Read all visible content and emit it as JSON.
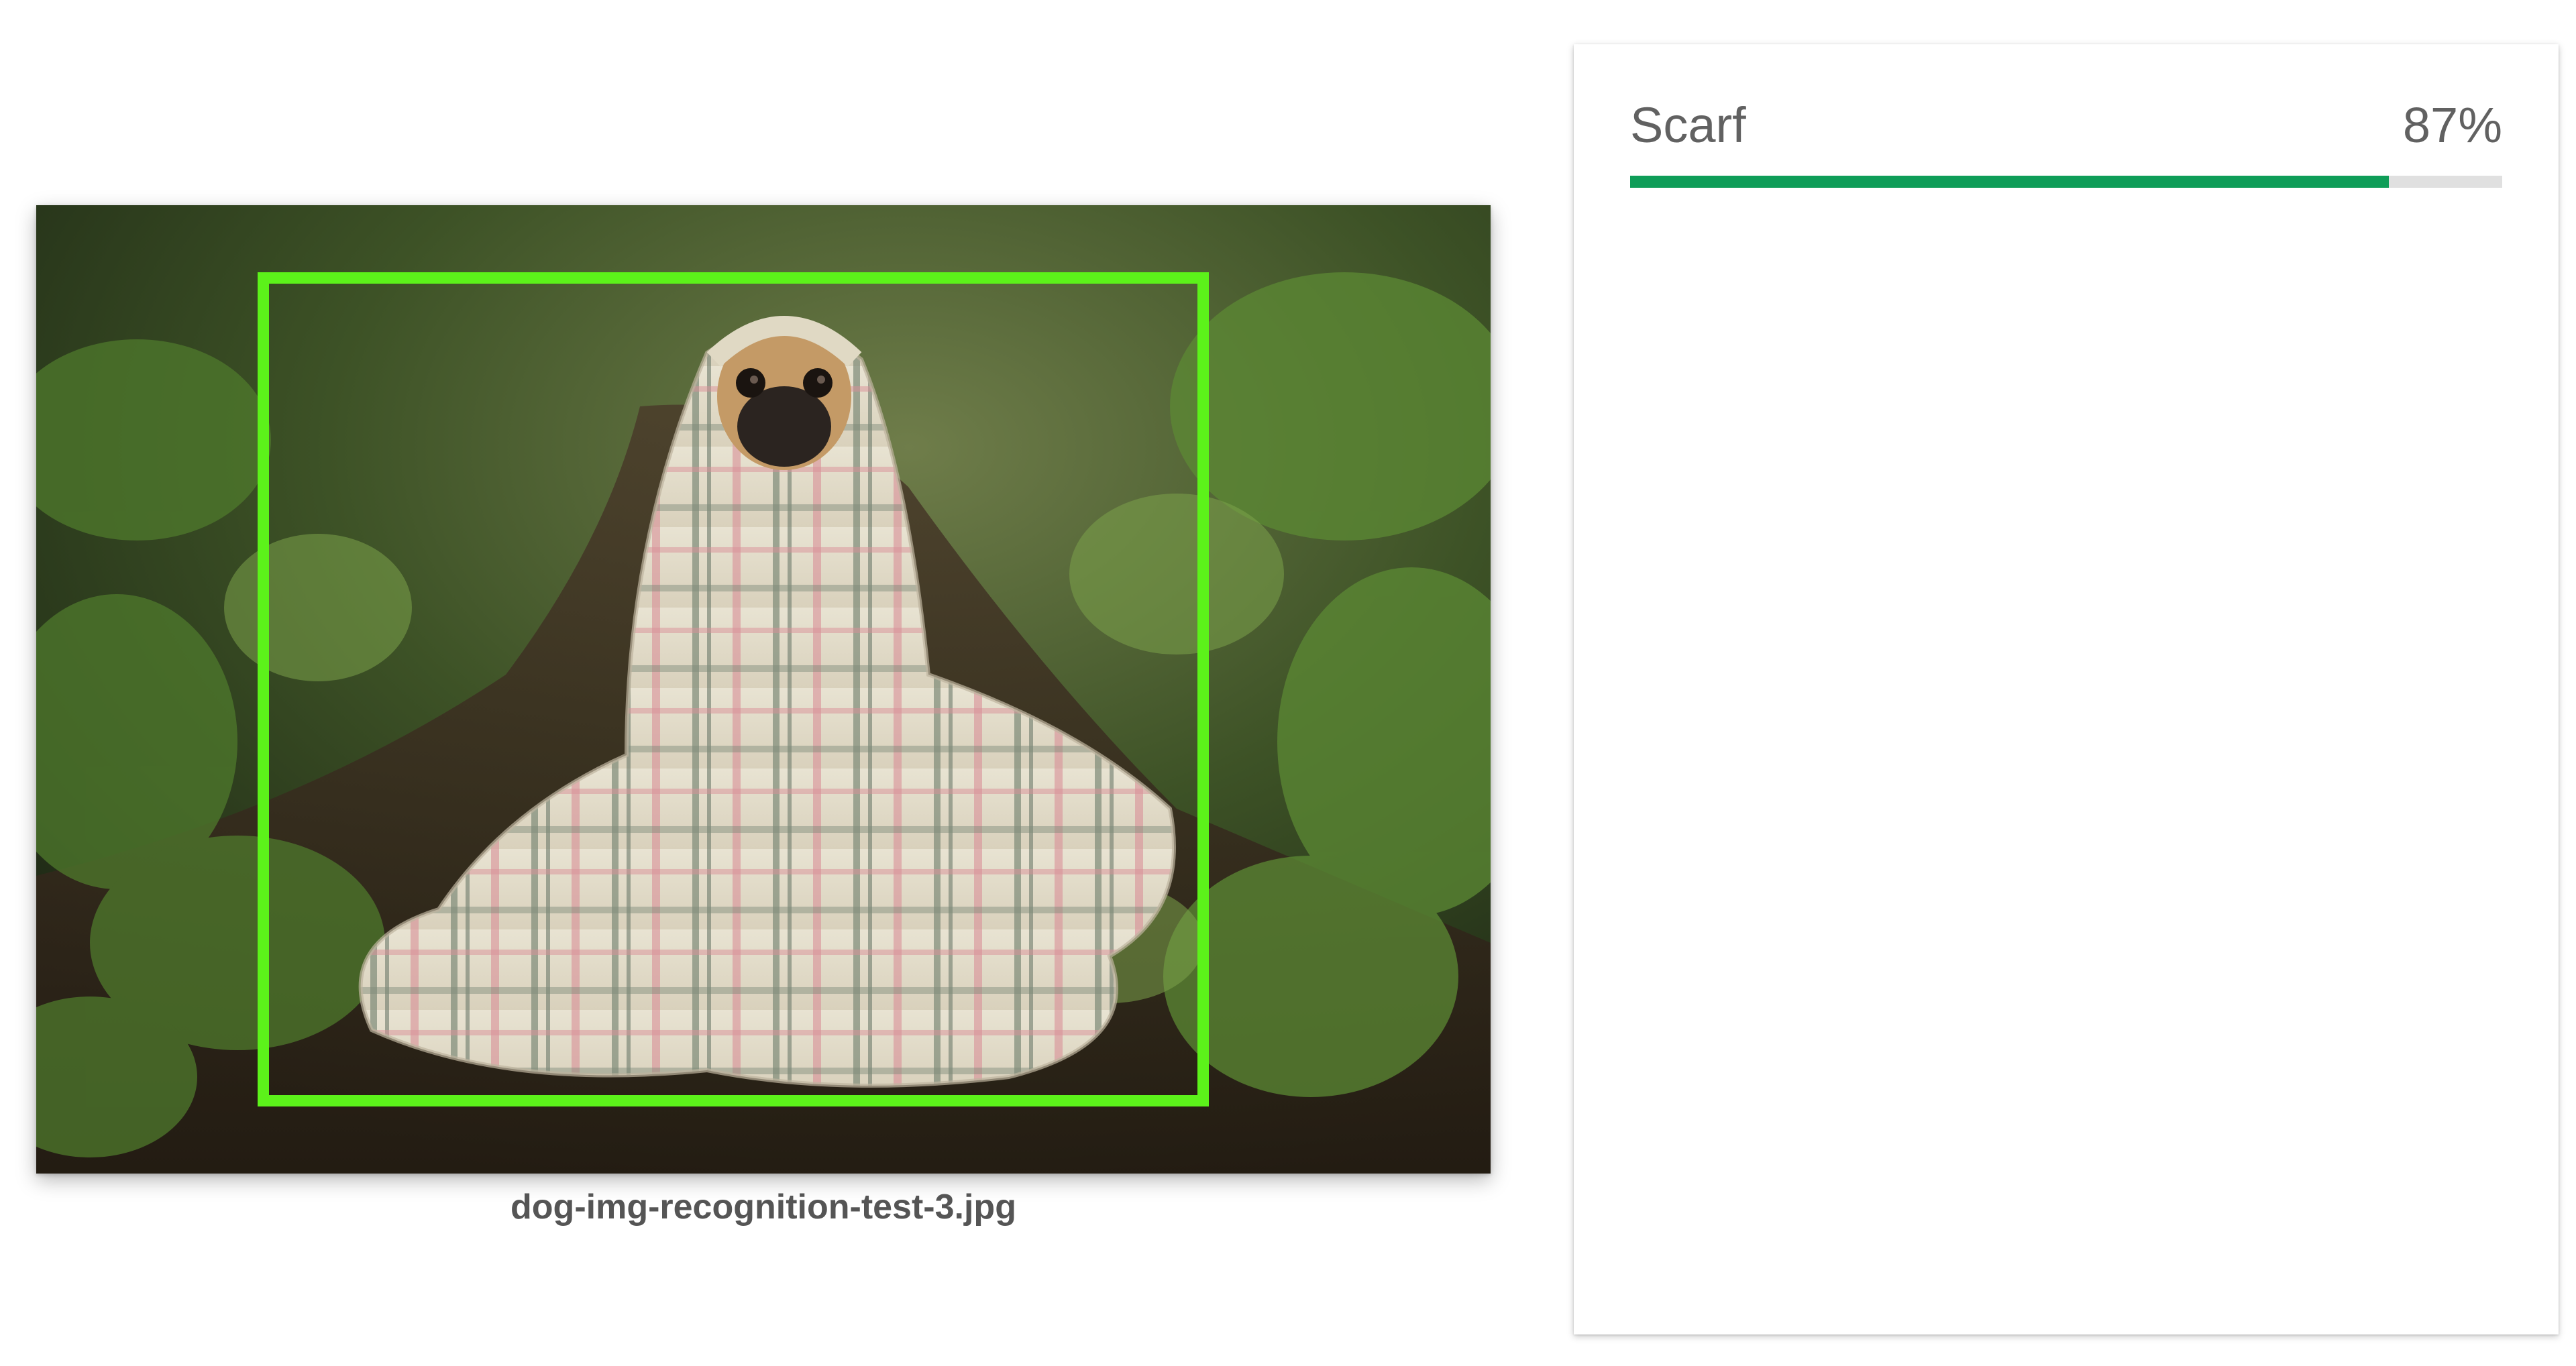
{
  "image": {
    "file_name": "dog-img-recognition-test-3.jpg",
    "bbox_color": "#5cf21a"
  },
  "results": [
    {
      "label": "Scarf",
      "confidence_text": "87%",
      "confidence": 0.87,
      "bar_color": "#0f9d58"
    }
  ]
}
